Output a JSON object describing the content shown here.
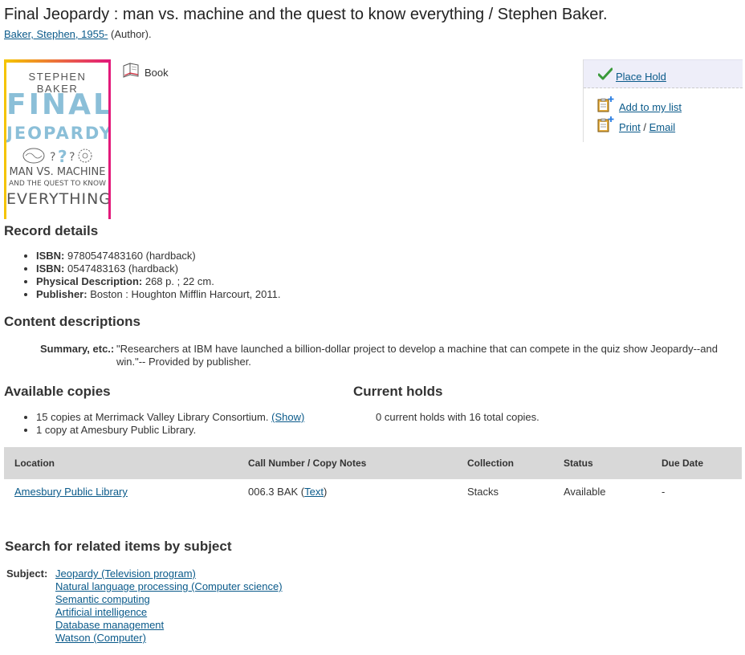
{
  "title": "Final Jeopardy : man vs. machine and the quest to know everything / Stephen Baker.",
  "author": {
    "name": "Baker, Stephen, 1955-",
    "role": "(Author)."
  },
  "cover": {
    "author": "STEPHEN BAKER",
    "line1": "FINAL",
    "line2": "JEOPARDY",
    "line3": "MAN VS. MACHINE",
    "line4": "AND THE QUEST TO KNOW",
    "line5": "EVERYTHING"
  },
  "format": {
    "label": "Book",
    "icon": "open-book-icon"
  },
  "actions": {
    "place_hold": "Place Hold",
    "add_to_list": "Add to my list",
    "print": "Print",
    "separator": "/",
    "email": "Email"
  },
  "record_details": {
    "heading": "Record details",
    "items": [
      {
        "label": "ISBN:",
        "value": "9780547483160 (hardback)"
      },
      {
        "label": "ISBN:",
        "value": "0547483163 (hardback)"
      },
      {
        "label": "Physical Description:",
        "value": "268 p. ; 22 cm."
      },
      {
        "label": "Publisher:",
        "value": "Boston : Houghton Mifflin Harcourt, 2011."
      }
    ]
  },
  "content_descriptions": {
    "heading": "Content descriptions",
    "summary_label": "Summary, etc.:",
    "summary_text": "\"Researchers at IBM have launched a billion-dollar project to develop a machine that can compete in the quiz show Jeopardy--and win.\"-- Provided by publisher."
  },
  "available_copies": {
    "heading": "Available copies",
    "items": [
      {
        "text": "15 copies at Merrimack Valley Library Consortium.",
        "link": "(Show)"
      },
      {
        "text": "1 copy at Amesbury Public Library."
      }
    ]
  },
  "current_holds": {
    "heading": "Current holds",
    "text": "0 current holds with 16 total copies."
  },
  "copies_table": {
    "columns": [
      "Location",
      "Call Number / Copy Notes",
      "Collection",
      "Status",
      "Due Date"
    ],
    "rows": [
      {
        "location": "Amesbury Public Library",
        "call_number": "006.3 BAK",
        "call_paren_open": "(",
        "call_link": "Text",
        "call_paren_close": ")",
        "collection": "Stacks",
        "status": "Available",
        "due_date": "-"
      }
    ]
  },
  "related": {
    "heading": "Search for related items by subject",
    "label": "Subject:",
    "subjects": [
      "Jeopardy (Television program)",
      "Natural language processing (Computer science)",
      "Semantic computing",
      "Artificial intelligence",
      "Database management",
      "Watson (Computer)"
    ]
  },
  "colors": {
    "link": "#0a5a8a",
    "hold_bg": "#eeeef9",
    "table_header_bg": "#d8d8d8"
  }
}
